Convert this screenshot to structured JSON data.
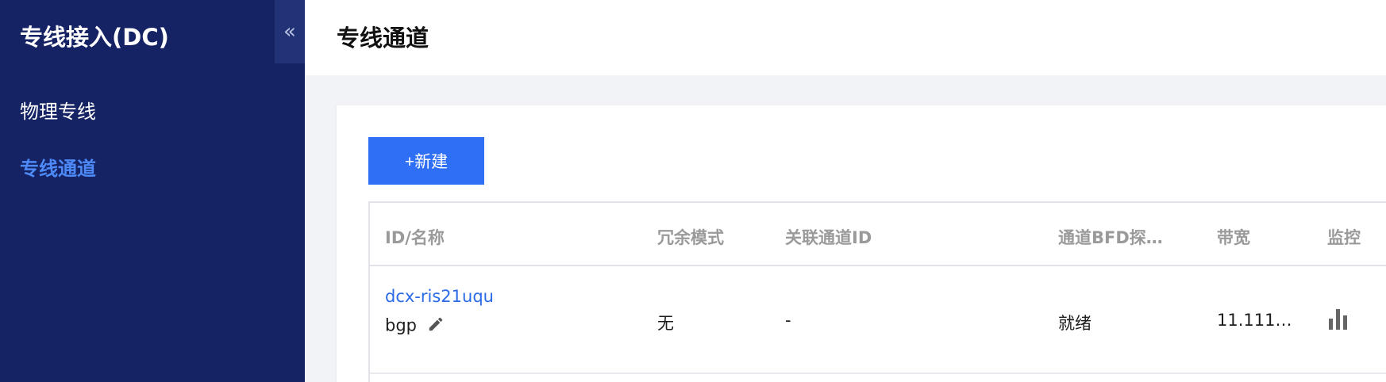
{
  "sidebar": {
    "title": "专线接入(DC)",
    "collapse_icon": "«",
    "items": [
      {
        "label": "物理专线",
        "active": false
      },
      {
        "label": "专线通道",
        "active": true
      }
    ]
  },
  "header": {
    "title": "专线通道"
  },
  "toolbar": {
    "new_label": "+新建"
  },
  "table": {
    "columns": [
      "ID/名称",
      "冗余模式",
      "关联通道ID",
      "通道BFD探…",
      "带宽",
      "监控"
    ],
    "rows": [
      {
        "id": "dcx-ris21uqu",
        "name": "bgp",
        "redundancy": "无",
        "related_channel_id": "-",
        "bfd_status": "就绪",
        "bandwidth": "11.111…"
      }
    ]
  },
  "colors": {
    "sidebar_bg": "#152364",
    "accent": "#2f6ff5",
    "active_nav": "#4d8af7",
    "link": "#2a6ae8"
  },
  "icons": {
    "collapse": "double-chevron-left-icon",
    "edit": "pencil-icon",
    "monitor": "bar-chart-icon"
  }
}
